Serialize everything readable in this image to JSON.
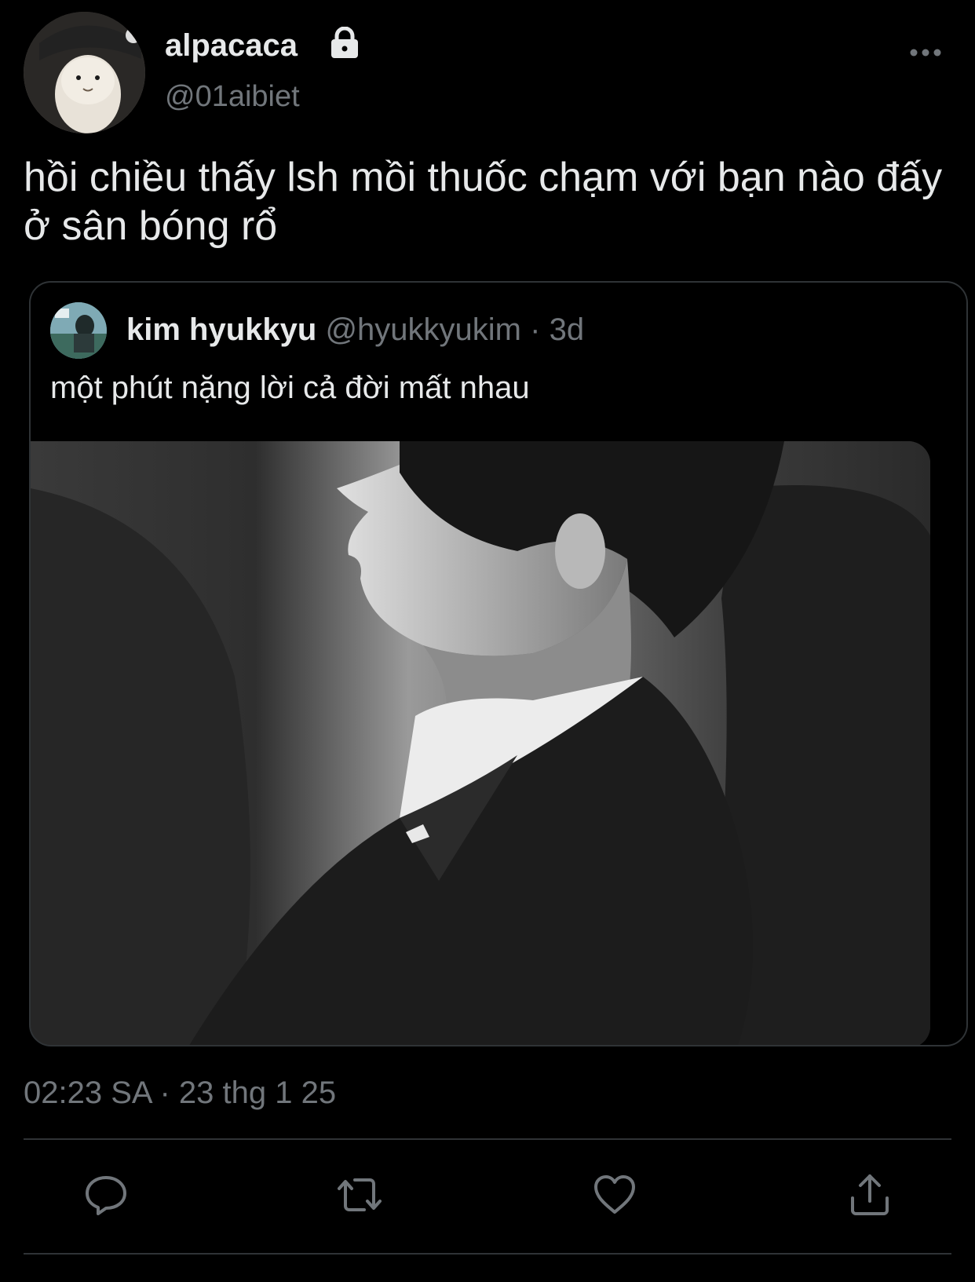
{
  "tweet": {
    "author": {
      "name": "alpacaca",
      "handle": "@01aibiet",
      "avatar_icon": "alpaca-plush-avatar",
      "protected_icon": "lock-icon"
    },
    "text": "hồi chiều thấy lsh mồi thuốc chạm với bạn nào đấy ở sân bóng rổ",
    "timestamp": "02:23 SA · 23 thg 1 25",
    "more_icon": "more-icon"
  },
  "quoted_tweet": {
    "name": "kim hyukkyu",
    "handle": "@hyukkyukim",
    "age": "· 3d",
    "text": "một phút nặng lời cả đời mất nhau",
    "media": "black-and-white photo"
  },
  "actions": [
    {
      "name": "reply",
      "icon": "reply-icon"
    },
    {
      "name": "retweet",
      "icon": "retweet-icon"
    },
    {
      "name": "like",
      "icon": "heart-icon"
    },
    {
      "name": "share",
      "icon": "share-icon"
    }
  ],
  "colors": {
    "background": "#000000",
    "text": "#e7e9ea",
    "secondary_text": "#71767b",
    "border": "#2f3336"
  }
}
